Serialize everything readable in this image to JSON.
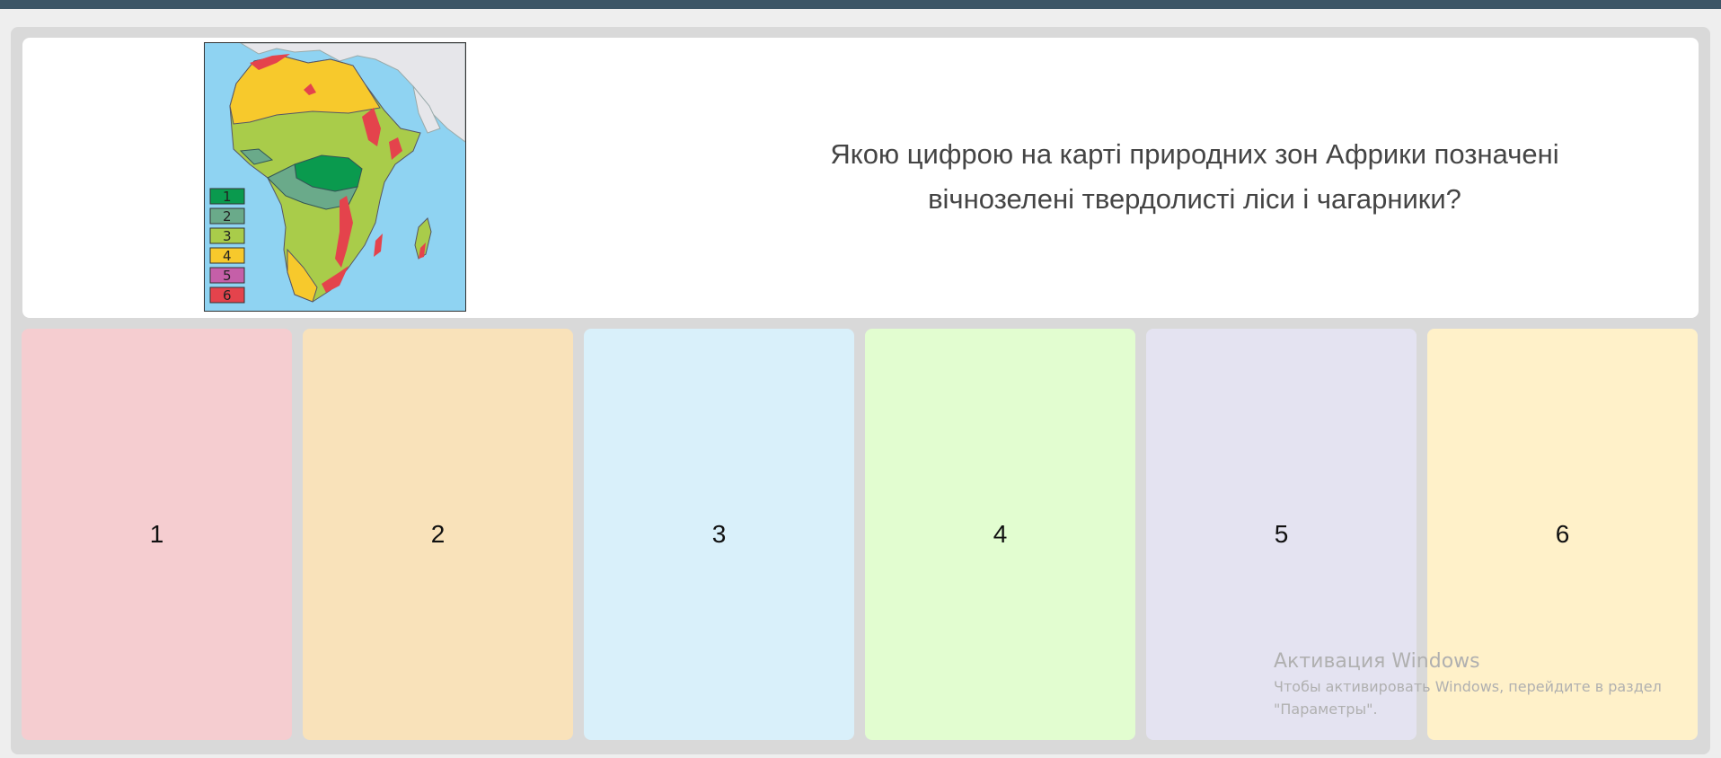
{
  "question": {
    "line1": "Якою цифрою на карті природних зон Африки позначені",
    "line2": "вічнозелені твердолисті ліси і чагарники?"
  },
  "map": {
    "legend": [
      {
        "label": "1",
        "color": "#0a9a4e"
      },
      {
        "label": "2",
        "color": "#6aaa8a"
      },
      {
        "label": "3",
        "color": "#a9cc4a"
      },
      {
        "label": "4",
        "color": "#f7c92c"
      },
      {
        "label": "5",
        "color": "#c55fa8"
      },
      {
        "label": "6",
        "color": "#e4434c"
      }
    ]
  },
  "answers": [
    {
      "label": "1",
      "color": "#f5cdd0"
    },
    {
      "label": "2",
      "color": "#f9e2ba"
    },
    {
      "label": "3",
      "color": "#d9f0fa"
    },
    {
      "label": "4",
      "color": "#e2fdd0"
    },
    {
      "label": "5",
      "color": "#e4e3f1"
    },
    {
      "label": "6",
      "color": "#fff1c9"
    }
  ],
  "watermark": {
    "title": "Активация Windows",
    "line1": "Чтобы активировать Windows, перейдите в раздел",
    "line2": "\"Параметры\"."
  }
}
